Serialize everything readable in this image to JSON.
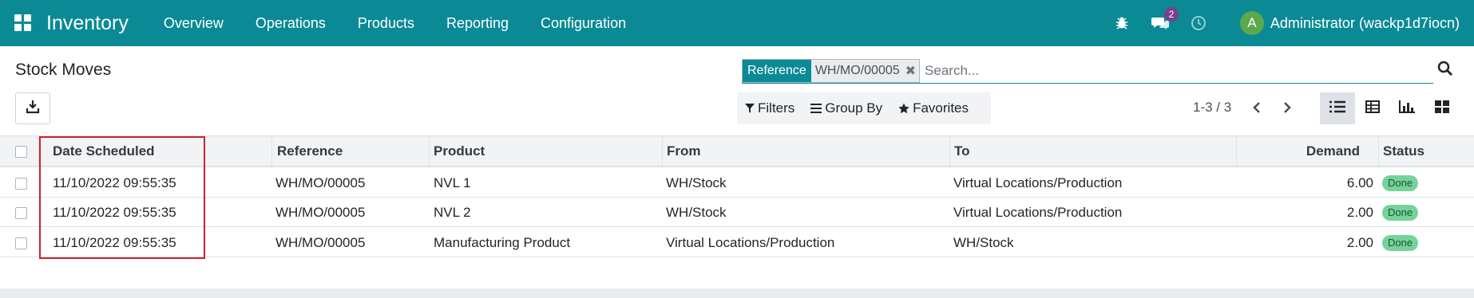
{
  "navbar": {
    "app_name": "Inventory",
    "menu": [
      "Overview",
      "Operations",
      "Products",
      "Reporting",
      "Configuration"
    ],
    "messages_count": "2",
    "avatar_letter": "A",
    "user_name": "Administrator (wackp1d7iocn)",
    "colors": {
      "navbar_bg": "#0b8a96",
      "badge": "#7b3f8e",
      "avatar": "#5ca84b"
    },
    "icons": [
      "apps-grid-icon",
      "bug-icon",
      "chat-icon",
      "clock-icon"
    ]
  },
  "control_panel": {
    "title": "Stock Moves",
    "facet": {
      "label": "Reference",
      "value": "WH/MO/00005"
    },
    "search_placeholder": "Search...",
    "filters_label": "Filters",
    "group_by_label": "Group By",
    "favorites_label": "Favorites",
    "pager": "1-3 / 3",
    "active_view": "list"
  },
  "table": {
    "columns": [
      "Date Scheduled",
      "Reference",
      "Product",
      "From",
      "To",
      "Demand",
      "Status"
    ],
    "rows": [
      {
        "date": "11/10/2022 09:55:35",
        "reference": "WH/MO/00005",
        "product": "NVL 1",
        "from": "WH/Stock",
        "to": "Virtual Locations/Production",
        "demand": "6.00",
        "status": "Done"
      },
      {
        "date": "11/10/2022 09:55:35",
        "reference": "WH/MO/00005",
        "product": "NVL 2",
        "from": "WH/Stock",
        "to": "Virtual Locations/Production",
        "demand": "2.00",
        "status": "Done"
      },
      {
        "date": "11/10/2022 09:55:35",
        "reference": "WH/MO/00005",
        "product": "Manufacturing Product",
        "from": "Virtual Locations/Production",
        "to": "WH/Stock",
        "demand": "2.00",
        "status": "Done"
      }
    ],
    "status_color": "#75d39a"
  }
}
